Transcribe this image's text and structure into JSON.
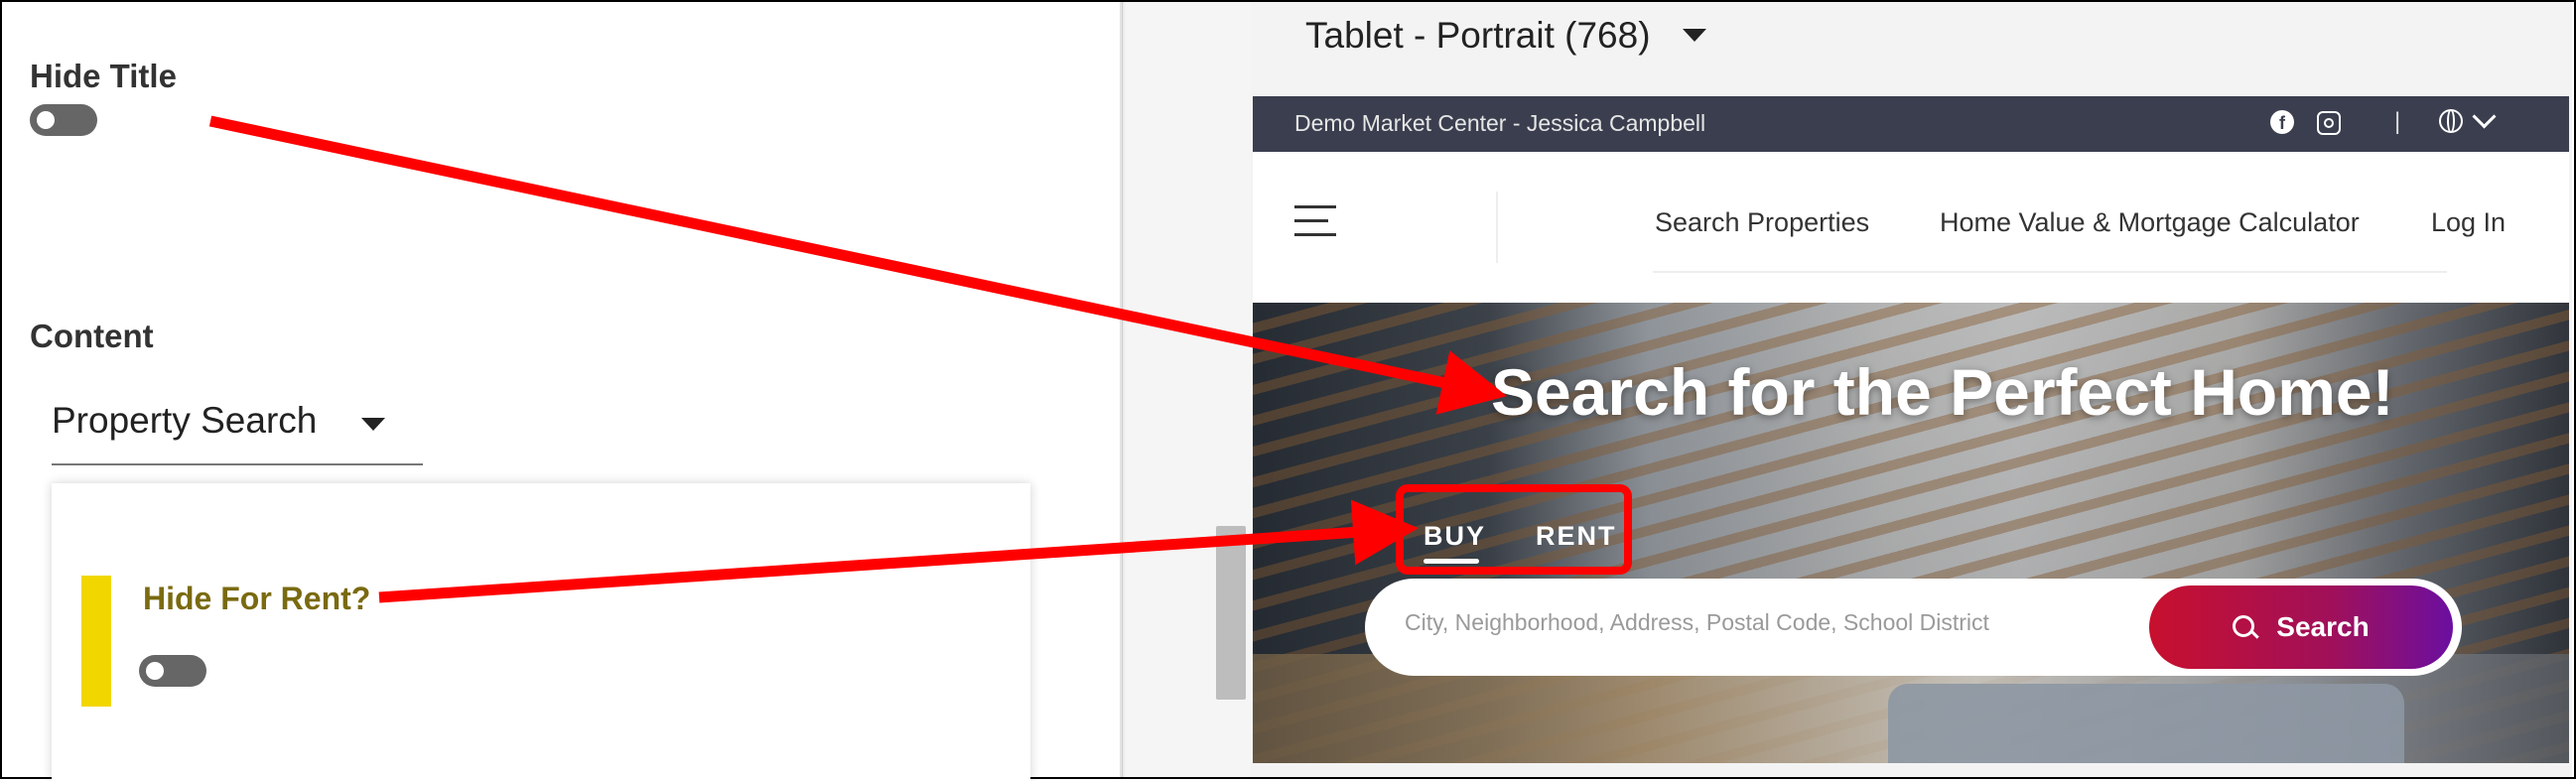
{
  "editor": {
    "hide_title_label": "Hide Title",
    "content_label": "Content",
    "content_select_value": "Property Search",
    "hide_for_rent_label": "Hide For Rent?"
  },
  "preview": {
    "device_label": "Tablet - Portrait (768)",
    "topbar_text": "Demo Market Center - Jessica Campbell",
    "topbar_separator": "|",
    "nav": {
      "search_properties": "Search Properties",
      "calculator": "Home Value & Mortgage Calculator",
      "login": "Log In"
    },
    "hero_title": "Search for the Perfect Home!",
    "tabs": {
      "buy": "BUY",
      "rent": "RENT"
    },
    "search_placeholder": "City, Neighborhood, Address, Postal Code, School District",
    "search_button": "Search"
  },
  "colors": {
    "annotation_arrow": "#ff0000",
    "topbar": "#3a3e4e",
    "yellow_indicator": "#f2d600",
    "hide_for_rent_text": "#7a6a10",
    "search_gradient_start": "#c8102e",
    "search_gradient_end": "#6b0fa0"
  },
  "icons": [
    "facebook-icon",
    "instagram-icon",
    "globe-icon",
    "chevron-down-icon",
    "hamburger-icon",
    "search-icon",
    "caret-down-icon"
  ]
}
